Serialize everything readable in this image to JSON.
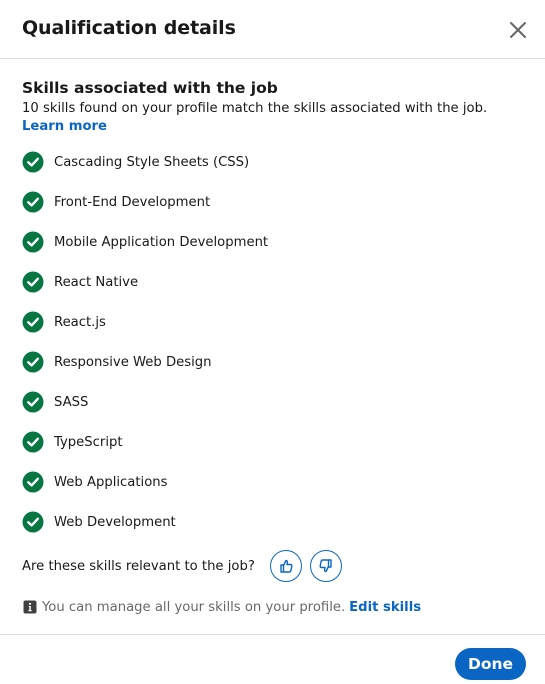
{
  "dialog": {
    "title": "Qualification details",
    "close_label": "Close"
  },
  "section": {
    "title": "Skills associated with the job",
    "subtitle": "10 skills found on your profile match the skills associated with the job.",
    "learn_more": "Learn more"
  },
  "skills": [
    {
      "label": "Cascading Style Sheets (CSS)",
      "icon": "check-circle-icon"
    },
    {
      "label": "Front-End Development",
      "icon": "check-circle-icon"
    },
    {
      "label": "Mobile Application Development",
      "icon": "check-circle-icon"
    },
    {
      "label": "React Native",
      "icon": "check-circle-icon"
    },
    {
      "label": "React.js",
      "icon": "check-circle-icon"
    },
    {
      "label": "Responsive Web Design",
      "icon": "check-circle-icon"
    },
    {
      "label": "SASS",
      "icon": "check-circle-icon"
    },
    {
      "label": "TypeScript",
      "icon": "check-circle-icon"
    },
    {
      "label": "Web Applications",
      "icon": "check-circle-icon"
    },
    {
      "label": "Web Development",
      "icon": "check-circle-icon"
    }
  ],
  "feedback": {
    "question": "Are these skills relevant to the job?",
    "thumbs_up_icon": "thumbs-up-icon",
    "thumbs_down_icon": "thumbs-down-icon"
  },
  "manage": {
    "text": "You can manage all your skills on your profile.",
    "link": "Edit skills",
    "icon": "info-icon"
  },
  "footer": {
    "done_label": "Done"
  },
  "colors": {
    "accent": "#0a66c2",
    "check": "#057642",
    "divider": "#e0dfdc"
  }
}
